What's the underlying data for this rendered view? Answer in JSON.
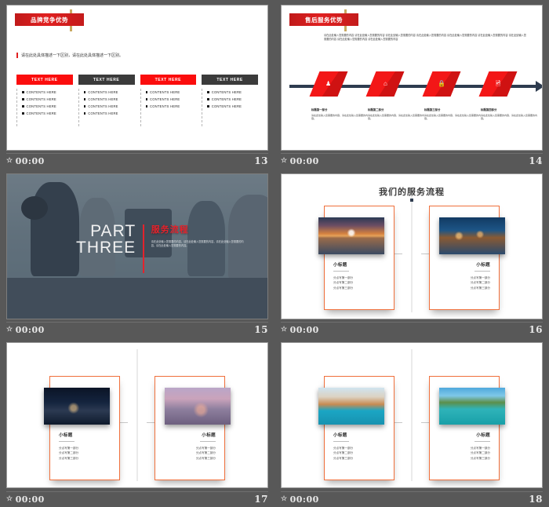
{
  "deck": {
    "footer_time": "00:00",
    "star_glyph": "☆"
  },
  "slides": [
    {
      "page": "13",
      "title": "品牌竞争优势",
      "lead": "请在此处具体描述一下区别，请在此处具体描述一下区别。",
      "columns": [
        {
          "head": "TEXT HERE",
          "style": "red",
          "items": [
            "CONTENTS HERE",
            "CONTENTS HERE",
            "CONTENTS HERE",
            "CONTENTS HERE"
          ]
        },
        {
          "head": "TEXT HERE",
          "style": "dark",
          "items": [
            "CONTENTS HERE",
            "CONTENTS HERE",
            "CONTENTS HERE",
            "CONTENTS HERE"
          ]
        },
        {
          "head": "TEXT HERE",
          "style": "red",
          "items": [
            "CONTENTS HERE",
            "CONTENTS HERE",
            "CONTENTS HERE"
          ]
        },
        {
          "head": "TEXT HERE",
          "style": "dark",
          "items": [
            "CONTENTS HERE",
            "CONTENTS HERE",
            "CONTENTS HERE"
          ]
        }
      ]
    },
    {
      "page": "14",
      "title": "售后服务优势",
      "paragraph": "请在此处输入您需要的内容 请在此处输入您需要的内容 请在此处输入您需要的内容 请在此处输入您需要的内容 请在此处输入您需要的内容 请在此处输入您需要的内容 请在此处输入您需要的内容 请在此处输入您需要的内容 请在此处输入您需要的内容",
      "timeline": [
        {
          "icon": "person-icon",
          "glyph": "♟",
          "heading": "标题第一部分",
          "text": "请在此处输入您需要的内容，请在此处输入您需要的内容。"
        },
        {
          "icon": "home-icon",
          "glyph": "⌂",
          "heading": "标题第二部分",
          "text": "请在此处输入您需要的内容，请在此处输入您需要的内容。"
        },
        {
          "icon": "lock-icon",
          "glyph": "🔒",
          "heading": "标题第三部分",
          "text": "请在此处输入您需要的内容，请在此处输入您需要的内容。"
        },
        {
          "icon": "briefcase-icon",
          "glyph": "🖻",
          "heading": "标题第四部分",
          "text": "请在此处输入您需要的内容，请在此处输入您需要的内容。"
        }
      ]
    },
    {
      "page": "15",
      "part_label_line1": "PART",
      "part_label_line2": "THREE",
      "section_title": "服务流程",
      "section_desc": "请在此处输入您需要的内容，请在此处输入您需要的内容，请在此处输入您需要的内容，请在此处输入您需要的内容。"
    },
    {
      "page": "16",
      "title": "我们的服务流程",
      "cards": [
        {
          "side": "left",
          "image": "taj-mahal-photo",
          "sub": "小标题",
          "lines": [
            "分点写第一部分",
            "分点写第二部分",
            "分点写第三部分"
          ]
        },
        {
          "side": "right",
          "image": "venice-night-photo",
          "sub": "小标题",
          "lines": [
            "分点写第一部分",
            "分点写第二部分",
            "分点写第三部分"
          ]
        }
      ]
    },
    {
      "page": "17",
      "title": "",
      "cards": [
        {
          "side": "left",
          "image": "newyork-skyline-photo",
          "sub": "小标题",
          "lines": [
            "分点写第一部分",
            "分点写第二部分",
            "分点写第三部分"
          ]
        },
        {
          "side": "right",
          "image": "dusk-skyline-photo",
          "sub": "小标题",
          "lines": [
            "分点写第一部分",
            "分点写第二部分",
            "分点写第三部分"
          ]
        }
      ]
    },
    {
      "page": "18",
      "title": "",
      "cards": [
        {
          "side": "left",
          "image": "venice-canal-photo",
          "sub": "小标题",
          "lines": [
            "分点写第一部分",
            "分点写第二部分",
            "分点写第三部分"
          ]
        },
        {
          "side": "right",
          "image": "lake-house-photo",
          "sub": "小标题",
          "lines": [
            "分点写第一部分",
            "分点写第二部分",
            "分点写第三部分"
          ]
        }
      ]
    }
  ],
  "colors": {
    "background": "#585858",
    "accent_red": "#e02020",
    "bright_red": "#fb0d0d",
    "dark_box": "#3b3b3b",
    "navy": "#2e3c4f",
    "card_border": "#f0703c",
    "gold": "#c9a860"
  }
}
